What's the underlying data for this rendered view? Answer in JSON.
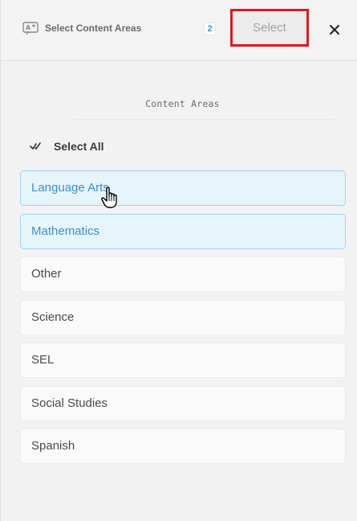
{
  "header": {
    "title": "Select Content Areas",
    "icon": "content-areas-icon",
    "selected_count": "2",
    "select_label": "Select",
    "close_icon": "close-icon"
  },
  "section": {
    "title": "Content Areas",
    "select_all_label": "Select All"
  },
  "items": [
    {
      "label": "Language Arts",
      "selected": true
    },
    {
      "label": "Mathematics",
      "selected": true
    },
    {
      "label": "Other",
      "selected": false
    },
    {
      "label": "Science",
      "selected": false
    },
    {
      "label": "SEL",
      "selected": false
    },
    {
      "label": "Social Studies",
      "selected": false
    },
    {
      "label": "Spanish",
      "selected": false
    }
  ],
  "colors": {
    "selected_bg": "#e6f5fc",
    "selected_text": "#3e8ec9",
    "highlight": "#e0181c"
  }
}
